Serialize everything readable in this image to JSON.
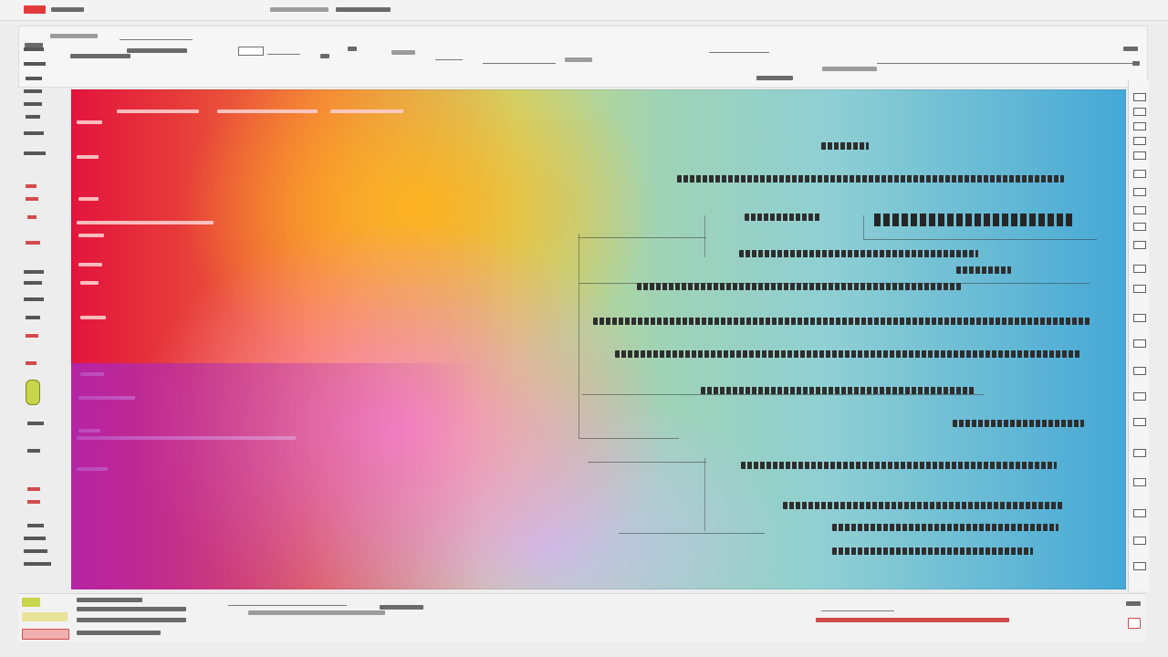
{
  "app": {
    "title": "",
    "accent_color": "#e23b3b",
    "rail_accent_color": "#c7d64a"
  },
  "icons": [
    "app-logo-icon",
    "menu-icon",
    "layers-icon",
    "brush-icon",
    "eraser-icon",
    "zoom-icon",
    "color-swatch-icon",
    "settings-icon",
    "close-icon"
  ],
  "canvas": {
    "background_colors": [
      "#e4143c",
      "#f27f3a",
      "#c8d676",
      "#9fd3b6",
      "#45a8d6",
      "#ff8cc8",
      "#aa28be"
    ]
  },
  "status": {
    "badge_color": "#d24b4b"
  }
}
